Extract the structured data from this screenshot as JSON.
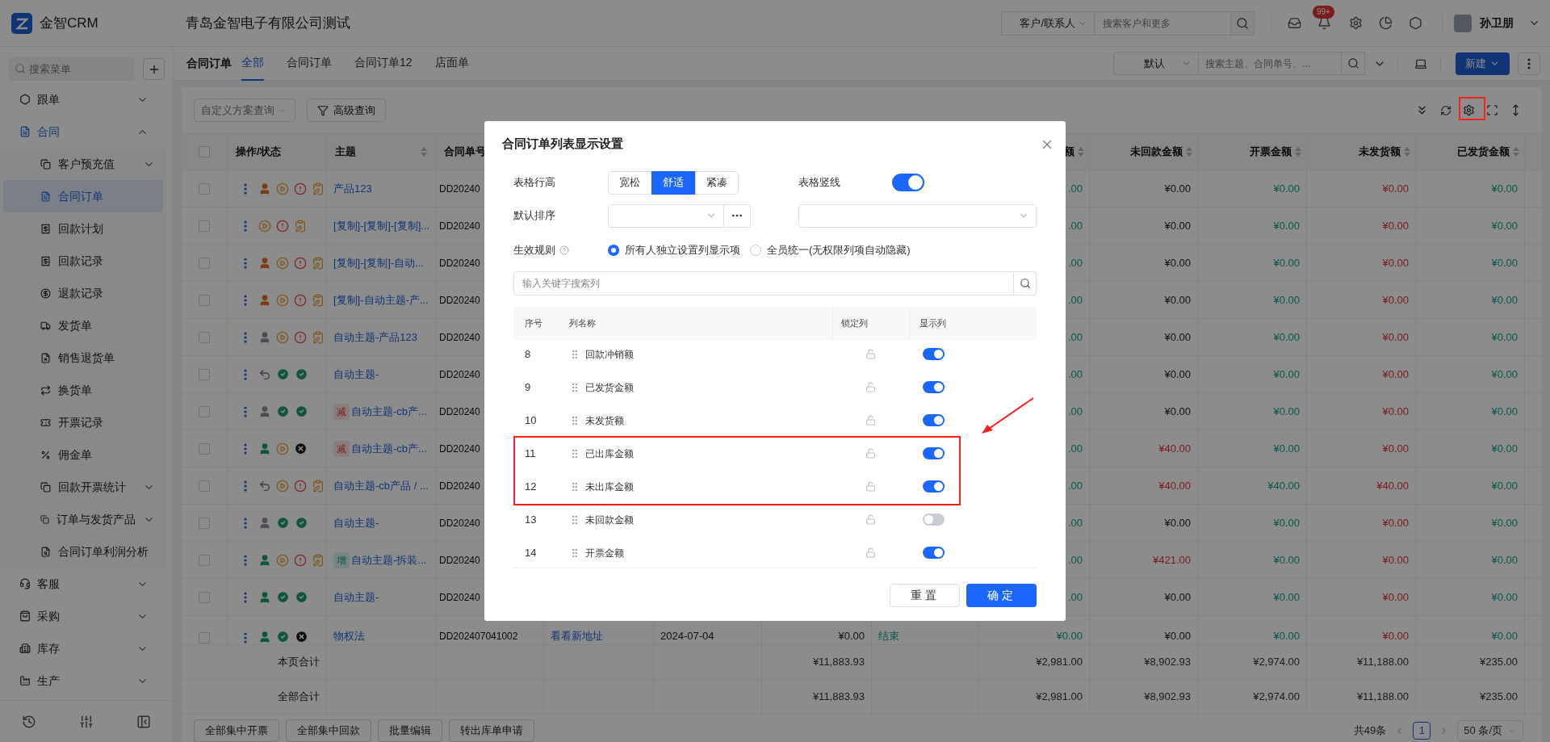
{
  "header": {
    "logo": "金智CRM",
    "company": "青岛金智电子有限公司测试",
    "search_scope": "客户/联系人",
    "search": {
      "placeholder": "搜索客户和更多"
    },
    "notification_badge": "99+",
    "user": "孙卫朋"
  },
  "sidebar": {
    "search": {
      "placeholder": "搜索菜单"
    },
    "items": [
      {
        "label": "跟单",
        "expanded": false,
        "selected": false
      },
      {
        "label": "合同",
        "expanded": true,
        "selected": false,
        "children": [
          {
            "label": "客户预充值",
            "expanded": false,
            "selected": false
          },
          {
            "label": "合同订单",
            "selected": true
          },
          {
            "label": "回款计划",
            "selected": false
          },
          {
            "label": "回款记录",
            "selected": false
          },
          {
            "label": "退款记录",
            "selected": false
          },
          {
            "label": "发货单",
            "selected": false
          },
          {
            "label": "销售退货单",
            "selected": false
          },
          {
            "label": "换货单",
            "selected": false
          },
          {
            "label": "开票记录",
            "selected": false
          },
          {
            "label": "佣金单",
            "selected": false
          },
          {
            "label": "回款开票统计",
            "expanded": false,
            "selected": false
          },
          {
            "label": "订单与发货产品",
            "expanded": false,
            "selected": false
          },
          {
            "label": "合同订单利润分析",
            "selected": false
          }
        ]
      },
      {
        "label": "客服",
        "expanded": false,
        "selected": false
      },
      {
        "label": "采购",
        "expanded": false,
        "selected": false
      },
      {
        "label": "库存",
        "expanded": false,
        "selected": false
      },
      {
        "label": "生产",
        "expanded": false,
        "selected": false
      }
    ]
  },
  "page_tabs": {
    "title": "合同订单",
    "tabs": [
      {
        "label": "全部",
        "selected": true
      },
      {
        "label": "合同订单",
        "selected": false
      },
      {
        "label": "合同订单12",
        "selected": false
      },
      {
        "label": "店面单",
        "selected": false
      }
    ],
    "view": "默认",
    "search": {
      "placeholder": "搜索主题、合同单号、..."
    },
    "new_button": "新建"
  },
  "toolbar": {
    "scheme_select": {
      "placeholder": "自定义方案查询"
    },
    "advanced_query": "高级查询",
    "settings_highlighted": true
  },
  "table": {
    "all_checked": false,
    "columns": [
      {
        "label": "操作/状态",
        "sortable": false
      },
      {
        "label": "主题",
        "sortable": true
      },
      {
        "label": "合同单号"
      },
      {
        "label": "额",
        "sortable": true
      },
      {
        "label": "未回款金额",
        "sortable": true
      },
      {
        "label": "开票金额",
        "sortable": true
      },
      {
        "label": "未发货额",
        "sortable": true
      },
      {
        "label": "已发货金额",
        "sortable": true
      }
    ],
    "rows": [
      {
        "checked": false,
        "status_icons": [
          {
            "kind": "user_pending"
          },
          {
            "kind": "play"
          },
          {
            "kind": "alert"
          },
          {
            "kind": "clipboard"
          }
        ],
        "subject": "产品123",
        "order_no": "DD20240",
        "amounts": [
          {
            "text": ".00",
            "kind": "positive"
          },
          {
            "text": "¥0.00",
            "kind": "plain"
          },
          {
            "text": "¥0.00",
            "kind": "positive"
          },
          {
            "text": "¥0.00",
            "kind": "negative"
          },
          {
            "text": "¥0.00",
            "kind": "positive"
          }
        ]
      },
      {
        "checked": false,
        "status_icons": [
          {
            "kind": "play"
          },
          {
            "kind": "alert"
          },
          {
            "kind": "clipboard"
          }
        ],
        "subject": "[复制]-[复制]-[复制]...",
        "order_no": "DD20240",
        "amounts": [
          {
            "text": ".00",
            "kind": "positive"
          },
          {
            "text": "¥0.00",
            "kind": "plain"
          },
          {
            "text": "¥0.00",
            "kind": "positive"
          },
          {
            "text": "¥0.00",
            "kind": "negative"
          },
          {
            "text": "¥0.00",
            "kind": "positive"
          }
        ]
      },
      {
        "checked": false,
        "status_icons": [
          {
            "kind": "user_pending"
          },
          {
            "kind": "play"
          },
          {
            "kind": "alert"
          },
          {
            "kind": "clipboard"
          }
        ],
        "subject": "[复制]-[复制]-自动...",
        "order_no": "DD20240",
        "amounts": [
          {
            "text": ".00",
            "kind": "positive"
          },
          {
            "text": "¥0.00",
            "kind": "plain"
          },
          {
            "text": "¥0.00",
            "kind": "positive"
          },
          {
            "text": "¥0.00",
            "kind": "negative"
          },
          {
            "text": "¥0.00",
            "kind": "positive"
          }
        ]
      },
      {
        "checked": false,
        "status_icons": [
          {
            "kind": "user_pending"
          },
          {
            "kind": "play"
          },
          {
            "kind": "alert"
          },
          {
            "kind": "clipboard"
          }
        ],
        "subject": "[复制]-自动主题-产...",
        "order_no": "DD20240",
        "amounts": [
          {
            "text": ".00",
            "kind": "positive"
          },
          {
            "text": "¥0.00",
            "kind": "plain"
          },
          {
            "text": "¥0.00",
            "kind": "positive"
          },
          {
            "text": "¥0.00",
            "kind": "negative"
          },
          {
            "text": "¥0.00",
            "kind": "positive"
          }
        ]
      },
      {
        "checked": false,
        "status_icons": [
          {
            "kind": "user_idle"
          },
          {
            "kind": "play"
          },
          {
            "kind": "alert"
          },
          {
            "kind": "clipboard"
          }
        ],
        "subject": "自动主题-产品123",
        "order_no": "DD20240",
        "amounts": [
          {
            "text": ".00",
            "kind": "positive"
          },
          {
            "text": "¥0.00",
            "kind": "plain"
          },
          {
            "text": "¥0.00",
            "kind": "positive"
          },
          {
            "text": "¥0.00",
            "kind": "negative"
          },
          {
            "text": "¥0.00",
            "kind": "positive"
          }
        ]
      },
      {
        "checked": false,
        "status_icons": [
          {
            "kind": "undo"
          },
          {
            "kind": "check"
          },
          {
            "kind": "check"
          }
        ],
        "subject": "自动主题-",
        "order_no": "DD20240",
        "amounts": [
          {
            "text": ".00",
            "kind": "positive"
          },
          {
            "text": "¥0.00",
            "kind": "plain"
          },
          {
            "text": "¥0.00",
            "kind": "positive"
          },
          {
            "text": "¥0.00",
            "kind": "negative"
          },
          {
            "text": "¥0.00",
            "kind": "positive"
          }
        ]
      },
      {
        "checked": false,
        "status_icons": [
          {
            "kind": "user_idle"
          },
          {
            "kind": "check"
          },
          {
            "kind": "check"
          }
        ],
        "tag": {
          "text": "减",
          "kind": "decrease"
        },
        "subject": "自动主题-cb产...",
        "order_no": "DD20240",
        "amounts": [
          {
            "text": ".00",
            "kind": "positive"
          },
          {
            "text": "¥0.00",
            "kind": "plain"
          },
          {
            "text": "¥0.00",
            "kind": "positive"
          },
          {
            "text": "¥0.00",
            "kind": "negative"
          },
          {
            "text": "¥0.00",
            "kind": "positive"
          }
        ]
      },
      {
        "checked": false,
        "status_icons": [
          {
            "kind": "user_approved"
          },
          {
            "kind": "play"
          },
          {
            "kind": "close"
          }
        ],
        "tag": {
          "text": "减",
          "kind": "decrease"
        },
        "subject": "自动主题-cb产...",
        "order_no": "DD20240",
        "amounts": [
          {
            "text": ".00",
            "kind": "positive"
          },
          {
            "text": "¥40.00",
            "kind": "negative"
          },
          {
            "text": "¥0.00",
            "kind": "positive"
          },
          {
            "text": "¥0.00",
            "kind": "negative"
          },
          {
            "text": "¥0.00",
            "kind": "positive"
          }
        ]
      },
      {
        "checked": false,
        "status_icons": [
          {
            "kind": "undo"
          },
          {
            "kind": "play"
          },
          {
            "kind": "alert"
          },
          {
            "kind": "clipboard"
          }
        ],
        "subject": "自动主题-cb产品 / ...",
        "order_no": "DD20240",
        "amounts": [
          {
            "text": ".00",
            "kind": "positive"
          },
          {
            "text": "¥40.00",
            "kind": "negative"
          },
          {
            "text": "¥40.00",
            "kind": "positive"
          },
          {
            "text": "¥40.00",
            "kind": "negative"
          },
          {
            "text": "¥0.00",
            "kind": "positive"
          }
        ]
      },
      {
        "checked": false,
        "status_icons": [
          {
            "kind": "user_idle"
          },
          {
            "kind": "check"
          },
          {
            "kind": "check"
          }
        ],
        "subject": "自动主题-",
        "order_no": "DD20240",
        "amounts": [
          {
            "text": ".00",
            "kind": "positive"
          },
          {
            "text": "¥0.00",
            "kind": "plain"
          },
          {
            "text": "¥0.00",
            "kind": "positive"
          },
          {
            "text": "¥0.00",
            "kind": "negative"
          },
          {
            "text": "¥0.00",
            "kind": "positive"
          }
        ]
      },
      {
        "checked": false,
        "status_icons": [
          {
            "kind": "user_approved"
          },
          {
            "kind": "play"
          },
          {
            "kind": "alert"
          },
          {
            "kind": "clipboard"
          }
        ],
        "tag": {
          "text": "增",
          "kind": "increase"
        },
        "subject": "自动主题-拆装...",
        "order_no": "DD20240",
        "amounts": [
          {
            "text": ".00",
            "kind": "positive"
          },
          {
            "text": "¥421.00",
            "kind": "negative"
          },
          {
            "text": "¥0.00",
            "kind": "positive"
          },
          {
            "text": "¥0.00",
            "kind": "negative"
          },
          {
            "text": "¥0.00",
            "kind": "positive"
          }
        ]
      },
      {
        "checked": false,
        "status_icons": [
          {
            "kind": "user_approved"
          },
          {
            "kind": "check"
          },
          {
            "kind": "check"
          }
        ],
        "subject": "自动主题-",
        "order_no": "DD20240",
        "amounts": [
          {
            "text": ".00",
            "kind": "positive"
          },
          {
            "text": "¥0.00",
            "kind": "plain"
          },
          {
            "text": "¥0.00",
            "kind": "positive"
          },
          {
            "text": "¥0.00",
            "kind": "negative"
          },
          {
            "text": "¥0.00",
            "kind": "positive"
          }
        ]
      },
      {
        "checked": false,
        "status_icons": [
          {
            "kind": "user_approved"
          },
          {
            "kind": "check"
          },
          {
            "kind": "close"
          }
        ],
        "subject": "物权法",
        "order_no": "DD202407041002",
        "details": {
          "address": "看看新地址",
          "date": "2024-07-04",
          "amount": "¥0.00",
          "status": "结束"
        },
        "amounts": [
          {
            "text": "¥0.00",
            "kind": "positive"
          },
          {
            "text": "¥0.00",
            "kind": "plain"
          },
          {
            "text": "¥0.00",
            "kind": "positive"
          },
          {
            "text": "¥0.00",
            "kind": "negative"
          },
          {
            "text": "¥0.00",
            "kind": "positive"
          }
        ]
      }
    ],
    "totals": [
      {
        "label": "本页合计",
        "amount": "¥11,883.93",
        "amounts": [
          "¥2,981.00",
          "¥8,902.93",
          "¥2,974.00",
          "¥11,188.00",
          "¥235.00"
        ]
      },
      {
        "label": "全部合计",
        "amount": "¥11,883.93",
        "amounts": [
          "¥2,981.00",
          "¥8,902.93",
          "¥2,974.00",
          "¥11,188.00",
          "¥235.00"
        ]
      }
    ]
  },
  "footer": {
    "buttons": [
      "全部集中开票",
      "全部集中回款",
      "批量编辑",
      "转出库单申请"
    ],
    "total": "共49条",
    "pages": [
      {
        "label": "1",
        "selected": true
      }
    ],
    "page_size": "50 条/页"
  },
  "modal": {
    "title": "合同订单列表显示设置",
    "row_height": {
      "label": "表格行高",
      "options": [
        {
          "label": "宽松",
          "selected": false
        },
        {
          "label": "舒适",
          "selected": true
        },
        {
          "label": "紧凑",
          "selected": false
        }
      ]
    },
    "vertical_lines": {
      "label": "表格竖线",
      "on": true
    },
    "default_sort": {
      "label": "默认排序"
    },
    "scope": {
      "label": "生效规则",
      "options": [
        {
          "label": "所有人独立设置列显示项",
          "selected": true
        },
        {
          "label": "全员统一(无权限列项自动隐藏)",
          "selected": false
        }
      ]
    },
    "search": {
      "placeholder": "输入关键字搜索列"
    },
    "columns": [
      "序号",
      "列名称",
      "锁定列",
      "显示列"
    ],
    "rows": [
      {
        "index": "8",
        "name": "回款冲销额",
        "locked": false,
        "visible": true,
        "highlighted": false
      },
      {
        "index": "9",
        "name": "已发货金额",
        "locked": false,
        "visible": true,
        "highlighted": false
      },
      {
        "index": "10",
        "name": "未发货额",
        "locked": false,
        "visible": true,
        "highlighted": false
      },
      {
        "index": "11",
        "name": "已出库金额",
        "locked": false,
        "visible": true,
        "highlighted": true
      },
      {
        "index": "12",
        "name": "未出库金额",
        "locked": false,
        "visible": true,
        "highlighted": true
      },
      {
        "index": "13",
        "name": "未回款金额",
        "locked": false,
        "visible": false,
        "highlighted": false
      },
      {
        "index": "14",
        "name": "开票金额",
        "locked": false,
        "visible": true,
        "highlighted": false
      }
    ],
    "buttons": {
      "reset": "重置",
      "confirm": "确定"
    }
  }
}
